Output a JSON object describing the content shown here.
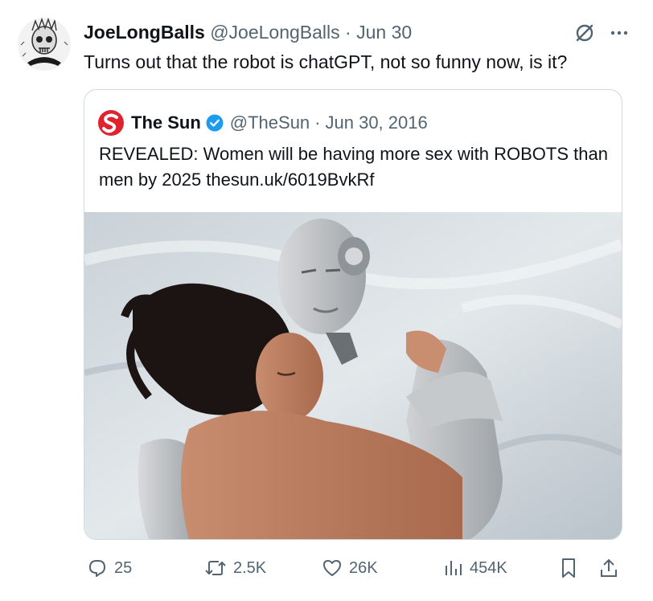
{
  "tweet": {
    "display_name": "JoeLongBalls",
    "handle": "@JoeLongBalls",
    "separator": "·",
    "date": "Jun 30",
    "text": "Turns out that the robot is chatGPT, not so funny now, is it?"
  },
  "quoted": {
    "display_name": "The Sun",
    "handle": "@TheSun",
    "separator": "·",
    "date": "Jun 30, 2016",
    "text": "REVEALED: Women will be having more sex with ROBOTS than men by 2025 thesun.uk/6019BvkRf"
  },
  "actions": {
    "replies": "25",
    "reposts": "2.5K",
    "likes": "26K",
    "views": "454K"
  },
  "icons": {
    "top_right": [
      "grok-icon",
      "more-icon"
    ],
    "actions": [
      "reply-icon",
      "repost-icon",
      "like-icon",
      "views-icon",
      "bookmark-icon",
      "share-icon"
    ]
  },
  "colors": {
    "text": "#0f1419",
    "secondary": "#536471",
    "verified": "#1d9bf0",
    "sun_logo": "#e0222e",
    "border": "#cfd9de"
  }
}
